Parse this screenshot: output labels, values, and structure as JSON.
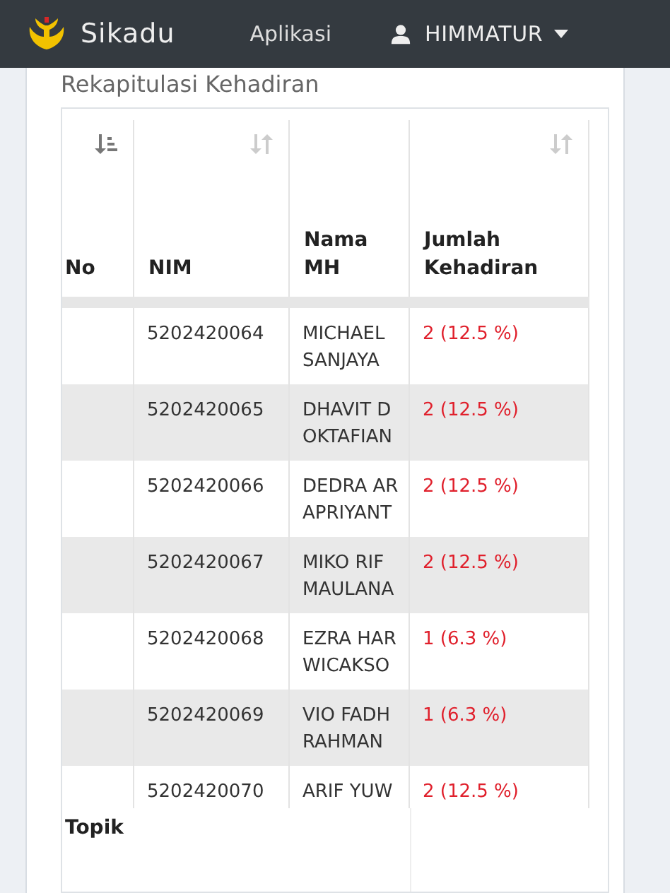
{
  "navbar": {
    "brand": "Sikadu",
    "menu": "Aplikasi",
    "user": "HIMMATUR"
  },
  "card": {
    "title": "Rekapitulasi Kehadiran"
  },
  "table": {
    "columns": [
      {
        "label": "No",
        "sorted": true
      },
      {
        "label": "NIM",
        "sorted": false
      },
      {
        "label": "Nama MH"
      },
      {
        "label": "Jumlah Kehadiran",
        "sorted": false
      }
    ],
    "rows": [
      {
        "nim": "5202420064",
        "name_lines": [
          "MICHAEL",
          "SANJAYA"
        ],
        "attendance": "2 (12.5 %)"
      },
      {
        "nim": "5202420065",
        "name_lines": [
          "DHAVIT D",
          "OKTAFIAN"
        ],
        "attendance": "2 (12.5 %)"
      },
      {
        "nim": "5202420066",
        "name_lines": [
          "DEDRA AR",
          "APRIYANT"
        ],
        "attendance": "2 (12.5 %)"
      },
      {
        "nim": "5202420067",
        "name_lines": [
          "MIKO RIF",
          "MAULANA"
        ],
        "attendance": "2 (12.5 %)"
      },
      {
        "nim": "5202420068",
        "name_lines": [
          "EZRA HAR",
          "WICAKSO"
        ],
        "attendance": "1 (6.3 %)"
      },
      {
        "nim": "5202420069",
        "name_lines": [
          "VIO FADH",
          "RAHMAN"
        ],
        "attendance": "1 (6.3 %)"
      },
      {
        "nim": "5202420070",
        "name_lines": [
          "ARIF YUW"
        ],
        "attendance": "2 (12.5 %)"
      }
    ],
    "footer_label": "Topik"
  }
}
